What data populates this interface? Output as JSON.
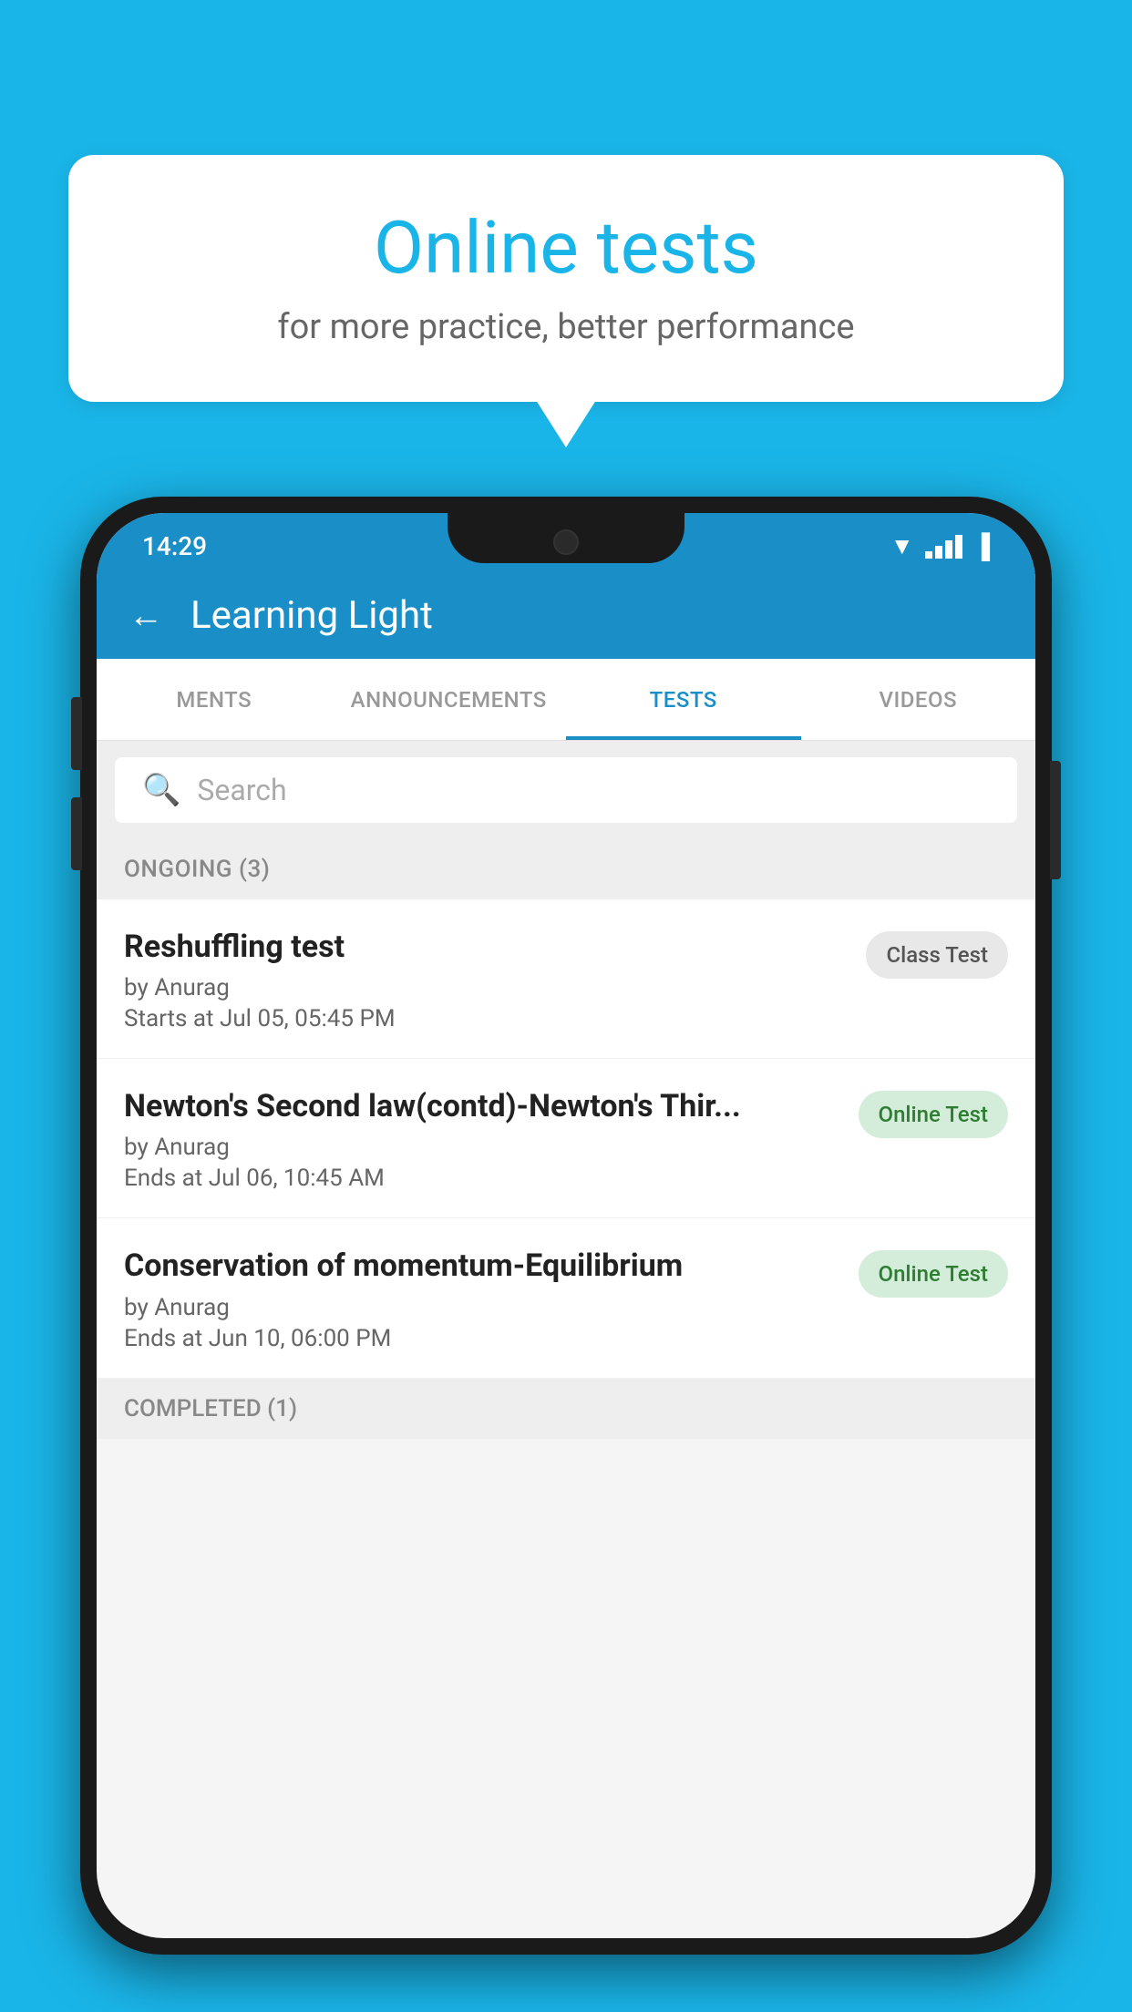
{
  "background_color": "#1ab5e8",
  "speech_bubble": {
    "title": "Online tests",
    "subtitle": "for more practice, better performance"
  },
  "phone": {
    "status_bar": {
      "time": "14:29",
      "icons": [
        "wifi",
        "signal",
        "battery"
      ]
    },
    "app_header": {
      "back_label": "←",
      "title": "Learning Light"
    },
    "tabs": [
      {
        "label": "MENTS",
        "active": false
      },
      {
        "label": "ANNOUNCEMENTS",
        "active": false
      },
      {
        "label": "TESTS",
        "active": true
      },
      {
        "label": "VIDEOS",
        "active": false
      }
    ],
    "search": {
      "placeholder": "Search"
    },
    "sections": [
      {
        "label": "ONGOING (3)",
        "tests": [
          {
            "title": "Reshuffling test",
            "author": "by Anurag",
            "time": "Starts at  Jul 05, 05:45 PM",
            "badge": "Class Test",
            "badge_type": "class"
          },
          {
            "title": "Newton's Second law(contd)-Newton's Thir...",
            "author": "by Anurag",
            "time": "Ends at  Jul 06, 10:45 AM",
            "badge": "Online Test",
            "badge_type": "online"
          },
          {
            "title": "Conservation of momentum-Equilibrium",
            "author": "by Anurag",
            "time": "Ends at  Jun 10, 06:00 PM",
            "badge": "Online Test",
            "badge_type": "online"
          }
        ]
      }
    ],
    "completed_section_label": "COMPLETED (1)"
  }
}
